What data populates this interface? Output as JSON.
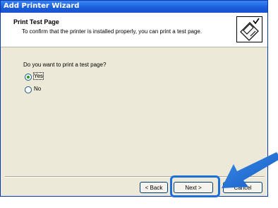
{
  "window": {
    "title": "Add Printer Wizard"
  },
  "header": {
    "title": "Print Test Page",
    "subtitle": "To confirm that the printer is installed properly, you can print a test page.",
    "icon": "printer-check-icon"
  },
  "main": {
    "question": "Do you want to print a test page?",
    "options": [
      {
        "label": "Yes",
        "selected": true
      },
      {
        "label": "No",
        "selected": false
      }
    ]
  },
  "buttons": {
    "back": "< Back",
    "next": "Next >",
    "cancel": "Cancel"
  },
  "colors": {
    "titlebar": "#1c5fdb",
    "dialog_bg": "#ece9d8",
    "highlight": "#1d6fd8",
    "radio_dot": "#21a121"
  }
}
